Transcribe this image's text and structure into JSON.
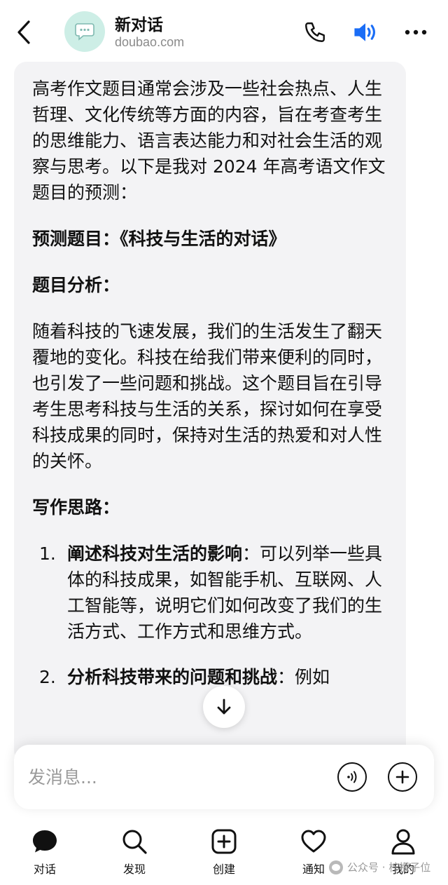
{
  "header": {
    "title": "新对话",
    "subtitle": "doubao.com",
    "icons": [
      "back-icon",
      "chat-bubble-icon",
      "phone-icon",
      "speaker-icon",
      "more-icon"
    ],
    "accent_color": "#1a6df6"
  },
  "message": {
    "intro": "高考作文题目通常会涉及一些社会热点、人生哲理、文化传统等方面的内容，旨在考查考生的思维能力、语言表达能力和对社会生活的观察与思考。以下是我对 2024 年高考语文作文题目的预测：",
    "topic_heading": "预测题目：《科技与生活的对话》",
    "analysis_heading": "题目分析：",
    "analysis_text": "随着科技的飞速发展，我们的生活发生了翻天覆地的变化。科技在给我们带来便利的同时，也引发了一些问题和挑战。这个题目旨在引导考生思考科技与生活的关系，探讨如何在享受科技成果的同时，保持对生活的热爱和对人性的关怀。",
    "approach_heading": "写作思路：",
    "points": [
      {
        "num": "1.",
        "bold": "阐述科技对生活的影响",
        "text": "：可以列举一些具体的科技成果，如智能手机、互联网、人工智能等，说明它们如何改变了我们的生活方式、工作方式和思维方式。"
      },
      {
        "num": "2.",
        "bold": "分析科技带来的问题和挑战",
        "text": "：例如"
      }
    ]
  },
  "input": {
    "placeholder": "发消息..."
  },
  "nav": {
    "items": [
      {
        "label": "对话",
        "icon": "chat-icon"
      },
      {
        "label": "发现",
        "icon": "search-icon"
      },
      {
        "label": "创建",
        "icon": "plus-square-icon"
      },
      {
        "label": "通知",
        "icon": "heart-icon"
      },
      {
        "label": "我的",
        "icon": "user-icon"
      }
    ]
  },
  "watermark": "公众号 · 柠檬子位"
}
